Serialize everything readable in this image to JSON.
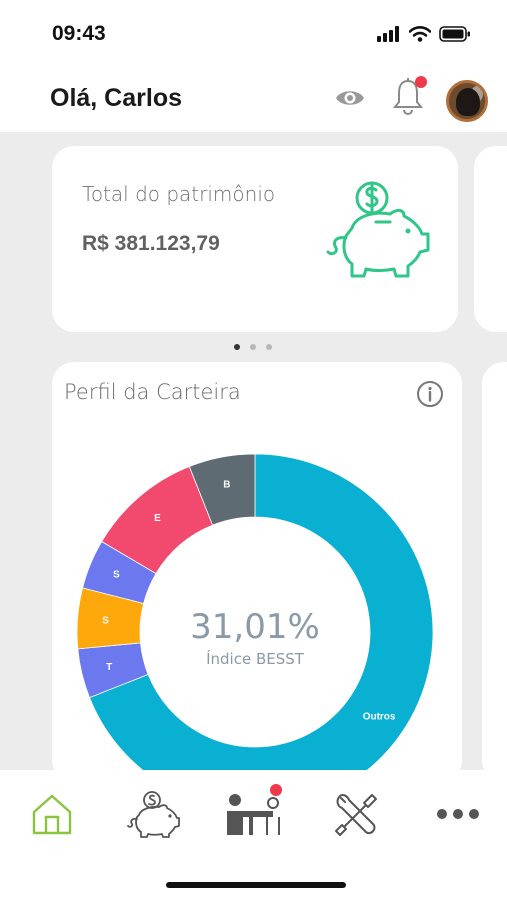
{
  "status_bar": {
    "time": "09:43"
  },
  "header": {
    "greeting": "Olá, Carlos",
    "notification_badge": true
  },
  "total_card": {
    "label": "Total do patrimônio",
    "value": "R$ 381.123,79",
    "icon": "piggy-bank-dollar-icon"
  },
  "carousel": {
    "pages": 3,
    "active": 0
  },
  "carteira_card": {
    "title": "Perfil da Carteira",
    "center_value": "31,01%",
    "center_label": "Índice BESST"
  },
  "chart_data": {
    "type": "pie",
    "variant": "donut",
    "center_value": "31,01%",
    "center_label": "Índice BESST",
    "slices": [
      {
        "label": "Outros",
        "value": 68.99,
        "color": "#09b0d2"
      },
      {
        "label": "T",
        "value": 4.5,
        "color": "#6c79ee"
      },
      {
        "label": "S",
        "value": 5.5,
        "color": "#ffa80b"
      },
      {
        "label": "S",
        "value": 4.5,
        "color": "#6c79ee"
      },
      {
        "label": "E",
        "value": 10.5,
        "color": "#f24a6f"
      },
      {
        "label": "B",
        "value": 6.01,
        "color": "#5f6b72"
      }
    ],
    "slice_labels_shown": [
      "Outros",
      "T",
      "S",
      "S",
      "E",
      "B"
    ]
  },
  "tabbar": {
    "items": [
      {
        "name": "home",
        "icon": "home-icon",
        "active": true
      },
      {
        "name": "investments",
        "icon": "piggy-bank-icon",
        "active": false
      },
      {
        "name": "advisor",
        "icon": "advisor-desk-icon",
        "active": false,
        "badge": true
      },
      {
        "name": "tools",
        "icon": "tools-icon",
        "active": false
      },
      {
        "name": "more",
        "icon": "more-dots-icon",
        "active": false
      }
    ]
  },
  "colors": {
    "accent_green": "#2fc688",
    "home_active": "#8ac43f",
    "badge_red": "#ef3a4b"
  }
}
